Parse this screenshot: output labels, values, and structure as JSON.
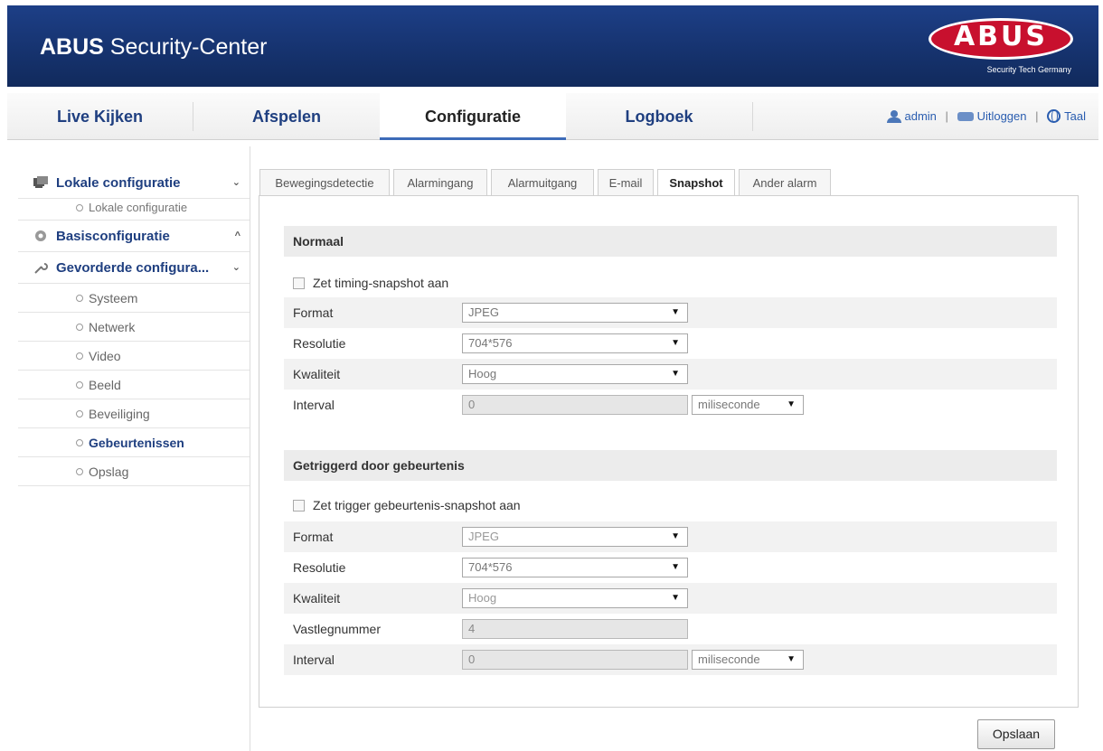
{
  "header": {
    "title_bold": "ABUS",
    "title_rest": " Security-Center",
    "logo_text": "ABUS",
    "logo_tagline": "Security Tech Germany"
  },
  "nav": {
    "tabs": [
      {
        "label": "Live Kijken"
      },
      {
        "label": "Afspelen"
      },
      {
        "label": "Configuratie"
      },
      {
        "label": "Logboek"
      }
    ],
    "active": "Configuratie",
    "user": "admin",
    "logout": "Uitloggen",
    "language": "Taal"
  },
  "sidebar": {
    "sections": [
      {
        "label": "Lokale configuratie",
        "icon": "local-config-icon",
        "chevron": "⌄"
      },
      {
        "label": "Basisconfiguratie",
        "icon": "basic-config-icon",
        "chevron": "^"
      },
      {
        "label": "Gevorderde configura...",
        "icon": "wrench-icon",
        "chevron": "⌄"
      }
    ],
    "local_sub": "Lokale configuratie",
    "advanced_items": [
      {
        "label": "Systeem"
      },
      {
        "label": "Netwerk"
      },
      {
        "label": "Video"
      },
      {
        "label": "Beeld"
      },
      {
        "label": "Beveiliging"
      },
      {
        "label": "Gebeurtenissen",
        "active": true
      },
      {
        "label": "Opslag"
      }
    ]
  },
  "tabs": [
    {
      "label": "Bewegingsdetectie"
    },
    {
      "label": "Alarmingang"
    },
    {
      "label": "Alarmuitgang"
    },
    {
      "label": "E-mail"
    },
    {
      "label": "Snapshot",
      "active": true
    },
    {
      "label": "Ander alarm"
    }
  ],
  "normal": {
    "heading": "Normaal",
    "checkbox": "Zet timing-snapshot aan",
    "format_label": "Format",
    "format_value": "JPEG",
    "resolution_label": "Resolutie",
    "resolution_value": "704*576",
    "quality_label": "Kwaliteit",
    "quality_value": "Hoog",
    "interval_label": "Interval",
    "interval_value": "0",
    "interval_unit": "miliseconde"
  },
  "triggered": {
    "heading": "Getriggerd door gebeurtenis",
    "checkbox": "Zet trigger gebeurtenis-snapshot aan",
    "format_label": "Format",
    "format_value": "JPEG",
    "resolution_label": "Resolutie",
    "resolution_value": "704*576",
    "quality_label": "Kwaliteit",
    "quality_value": "Hoog",
    "capture_label": "Vastlegnummer",
    "capture_value": "4",
    "interval_label": "Interval",
    "interval_value": "0",
    "interval_unit": "miliseconde"
  },
  "save_label": "Opslaan",
  "colors": {
    "header_bg": "#16336f",
    "brand_red": "#c8102e",
    "link_blue": "#1f3f80"
  }
}
